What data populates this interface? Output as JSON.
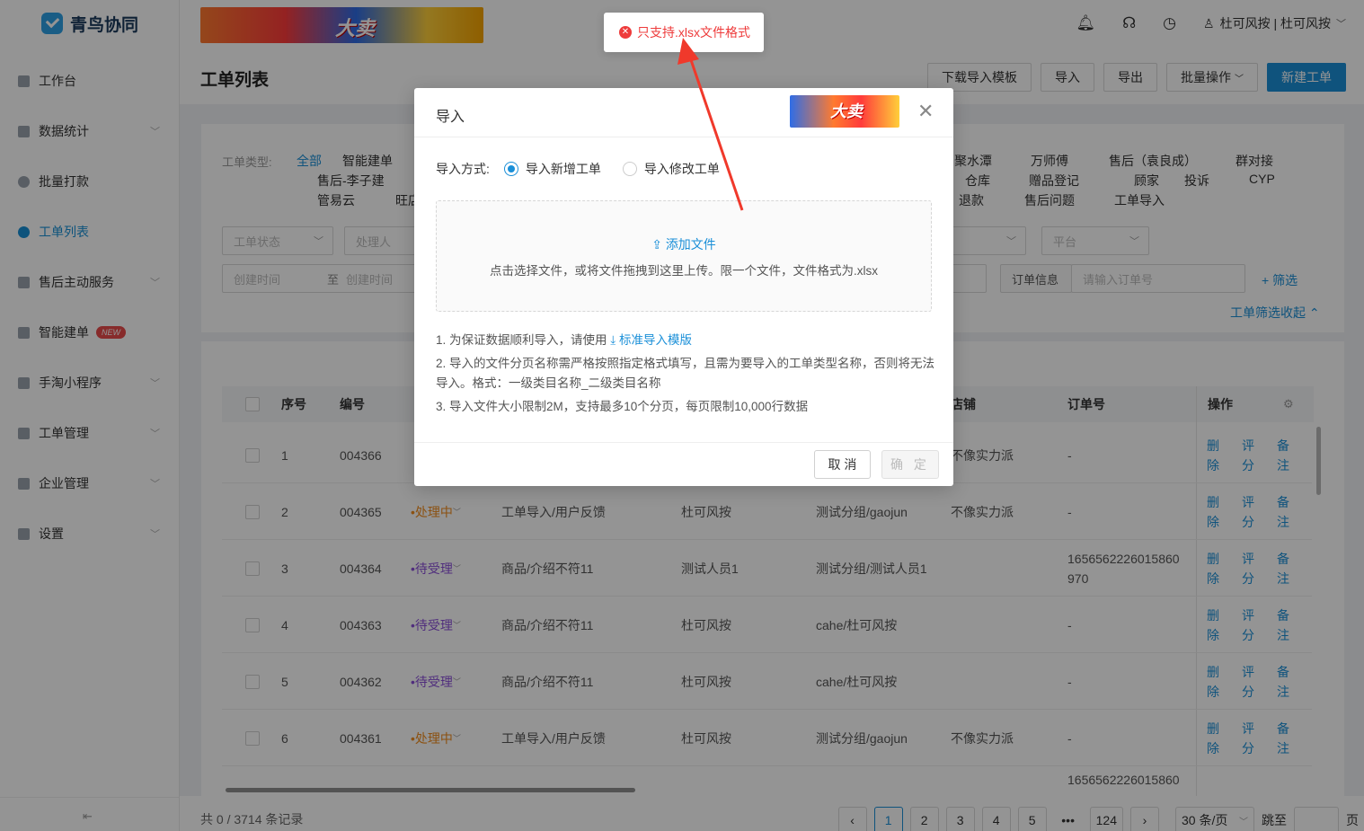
{
  "app": {
    "name": "青鸟协同"
  },
  "banner": {
    "text": "大卖"
  },
  "user": {
    "name": "杜可风按 | 杜可风按"
  },
  "sidebar": {
    "items": [
      {
        "label": "工作台",
        "icon": "dashboard-icon"
      },
      {
        "label": "数据统计",
        "icon": "chart-icon",
        "chevron": true
      },
      {
        "label": "批量打款",
        "icon": "payment-icon"
      },
      {
        "label": "工单列表",
        "icon": "list-icon",
        "active": true
      },
      {
        "label": "售后主动服务",
        "icon": "service-icon",
        "chevron": true
      },
      {
        "label": "智能建单",
        "icon": "smart-icon",
        "badge": "NEW"
      },
      {
        "label": "手淘小程序",
        "icon": "miniapp-icon",
        "chevron": true
      },
      {
        "label": "工单管理",
        "icon": "manage-icon",
        "chevron": true
      },
      {
        "label": "企业管理",
        "icon": "company-icon",
        "chevron": true
      },
      {
        "label": "设置",
        "icon": "settings-icon",
        "chevron": true
      }
    ]
  },
  "page": {
    "title": "工单列表",
    "actions": [
      "下载导入模板",
      "导入",
      "导出",
      "批量操作",
      "新建工单"
    ]
  },
  "filters": {
    "type_label": "工单类型:",
    "type_tags_left": [
      "全部",
      "智能建单",
      "售后-李子建",
      "管易云",
      "旺店"
    ],
    "type_tags_right": [
      "聚水潭",
      "万师傅",
      "售后（袁良成）",
      "群对接",
      "仓库",
      "赠品登记",
      "顾家",
      "投诉",
      "CYP",
      "退款",
      "售后问题",
      "工单导入"
    ],
    "status_placeholder": "工单状态",
    "handler_placeholder": "处理人",
    "platform_placeholder": "平台",
    "time_start": "创建时间",
    "time_sep": "至",
    "time_end": "创建时间",
    "order_label": "订单信息",
    "order_placeholder": "请输入订单号",
    "add_filter": "+ 筛选",
    "collapse": "工单筛选收起 ⌃"
  },
  "table": {
    "columns": [
      "序号",
      "编号",
      "店铺",
      "订单号",
      "操作"
    ],
    "rows": [
      {
        "idx": "1",
        "no": "004366",
        "status": "",
        "type": "",
        "person": "",
        "group": "",
        "shop": "不像实力派",
        "order": "-"
      },
      {
        "idx": "2",
        "no": "004365",
        "status": "处理中",
        "type": "工单导入/用户反馈",
        "person": "杜可风按",
        "group": "测试分组/gaojun",
        "shop": "不像实力派",
        "order": "-"
      },
      {
        "idx": "3",
        "no": "004364",
        "status": "待受理",
        "type": "商品/介绍不符11",
        "person": "测试人员1",
        "group": "测试分组/测试人员1",
        "shop": "",
        "order": "1656562226015860\n970"
      },
      {
        "idx": "4",
        "no": "004363",
        "status": "待受理",
        "type": "商品/介绍不符11",
        "person": "杜可风按",
        "group": "cahe/杜可风按",
        "shop": "",
        "order": "-"
      },
      {
        "idx": "5",
        "no": "004362",
        "status": "待受理",
        "type": "商品/介绍不符11",
        "person": "杜可风按",
        "group": "cahe/杜可风按",
        "shop": "",
        "order": "-"
      },
      {
        "idx": "6",
        "no": "004361",
        "status": "处理中",
        "type": "工单导入/用户反馈",
        "person": "杜可风按",
        "group": "测试分组/gaojun",
        "shop": "不像实力派",
        "order": "-"
      }
    ],
    "row_ops": [
      "删除",
      "评分",
      "备注"
    ],
    "partial_order": "1656562226015860"
  },
  "footer": {
    "total": "共 0 / 3714 条记录",
    "pages": [
      "1",
      "2",
      "3",
      "4",
      "5",
      "•••",
      "124"
    ],
    "page_size": "30 条/页",
    "jump_label": "跳至",
    "page_unit": "页"
  },
  "modal": {
    "title": "导入",
    "banner_text": "大卖",
    "mode_label": "导入方式:",
    "mode_options": [
      "导入新增工单",
      "导入修改工单"
    ],
    "add_file": "添加文件",
    "hint": "点击选择文件，或将文件拖拽到这里上传。限一个文件，文件格式为.xlsx",
    "note1_prefix": "1. 为保证数据顺利导入，请使用",
    "note1_link": "标准导入模版",
    "note2": "2. 导入的文件分页名称需严格按照指定格式填写，且需为要导入的工单类型名称，否则将无法导入。格式：一级类目名称_二级类目名称",
    "note3": "3. 导入文件大小限制2M，支持最多10个分页，每页限制10,000行数据",
    "cancel": "取 消",
    "ok": "确 定"
  },
  "toast": {
    "message": "只支持.xlsx文件格式"
  },
  "colors": {
    "accent": "#1a8fd8",
    "error": "#ee3b3b",
    "processing": "#f08c1e",
    "pending": "#8a4fd8",
    "arrow": "#f0392b"
  }
}
